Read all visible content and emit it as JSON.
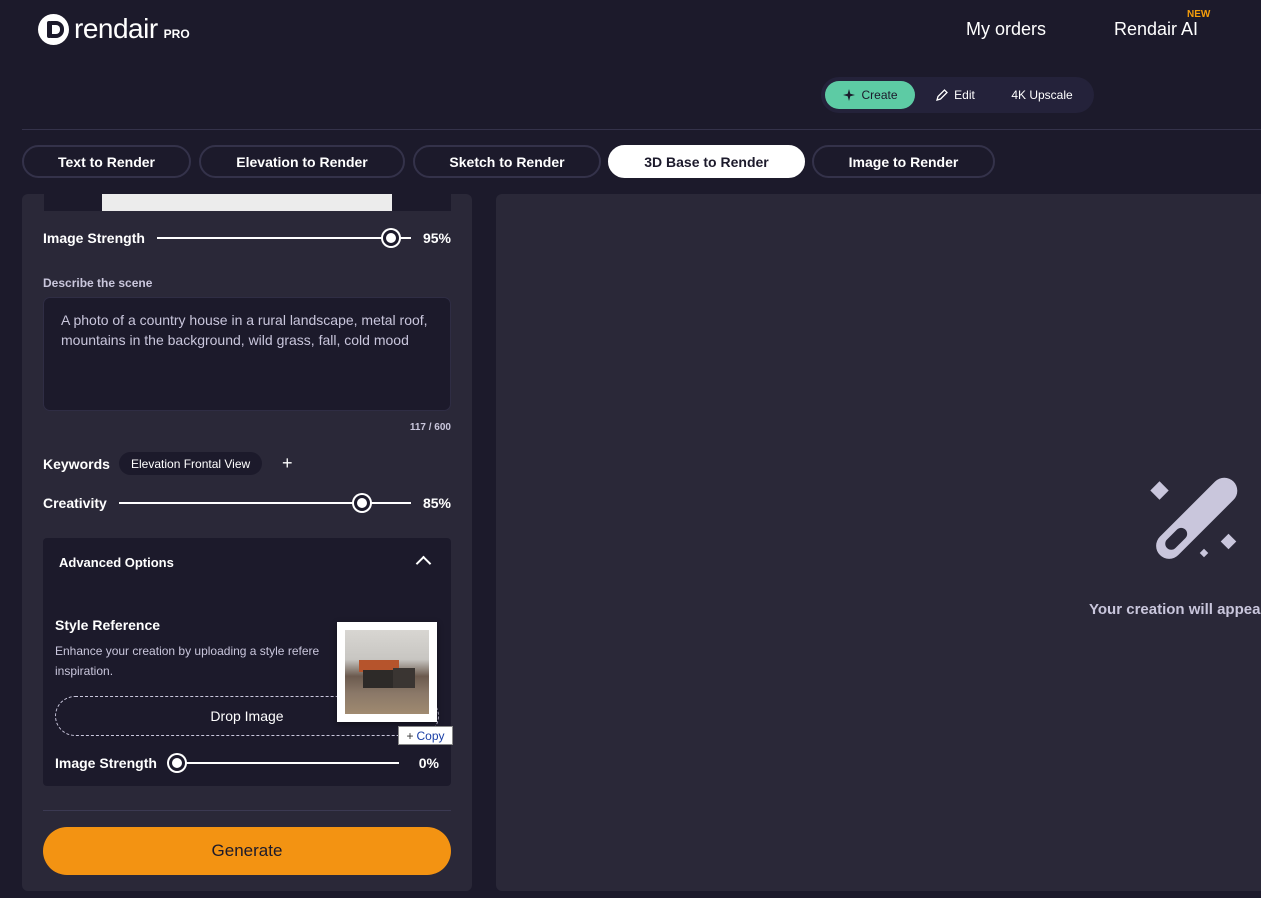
{
  "header": {
    "brand": "rendair",
    "brand_suffix": "PRO",
    "nav": {
      "orders": "My orders",
      "ai": "Rendair AI",
      "ai_badge": "NEW"
    }
  },
  "mode_switch": {
    "create": "Create",
    "edit": "Edit",
    "upscale": "4K Upscale",
    "active": "Create"
  },
  "tabs": [
    {
      "label": "Text to Render",
      "active": false
    },
    {
      "label": "Elevation to Render",
      "active": false
    },
    {
      "label": "Sketch to Render",
      "active": false
    },
    {
      "label": "3D Base to Render",
      "active": true
    },
    {
      "label": "Image to Render",
      "active": false
    }
  ],
  "form": {
    "image_strength": {
      "label": "Image Strength",
      "value": 95,
      "display": "95%"
    },
    "scene": {
      "label": "Describe the scene",
      "text": "A photo of a country house in a rural landscape, metal roof, mountains in the background, wild grass, fall, cold mood",
      "counter": "117 / 600"
    },
    "keywords": {
      "label": "Keywords",
      "items": [
        "Elevation Frontal View"
      ]
    },
    "creativity": {
      "label": "Creativity",
      "value": 85,
      "display": "85%"
    },
    "advanced": {
      "title": "Advanced Options",
      "style_title": "Style Reference",
      "style_desc": "Enhance your creation by uploading a style refere",
      "style_desc2": "inspiration.",
      "drop_label": "Drop Image",
      "strength": {
        "label": "Image Strength",
        "value": 0,
        "display": "0%"
      }
    },
    "generate_label": "Generate"
  },
  "drag": {
    "copy_label": "Copy"
  },
  "output": {
    "empty_text": "Your creation will appear"
  },
  "colors": {
    "accent_green": "#5dcba4",
    "accent_orange": "#f39312",
    "badge": "#f59e0b",
    "bg": "#1c1a2b",
    "panel": "#2a2838"
  }
}
